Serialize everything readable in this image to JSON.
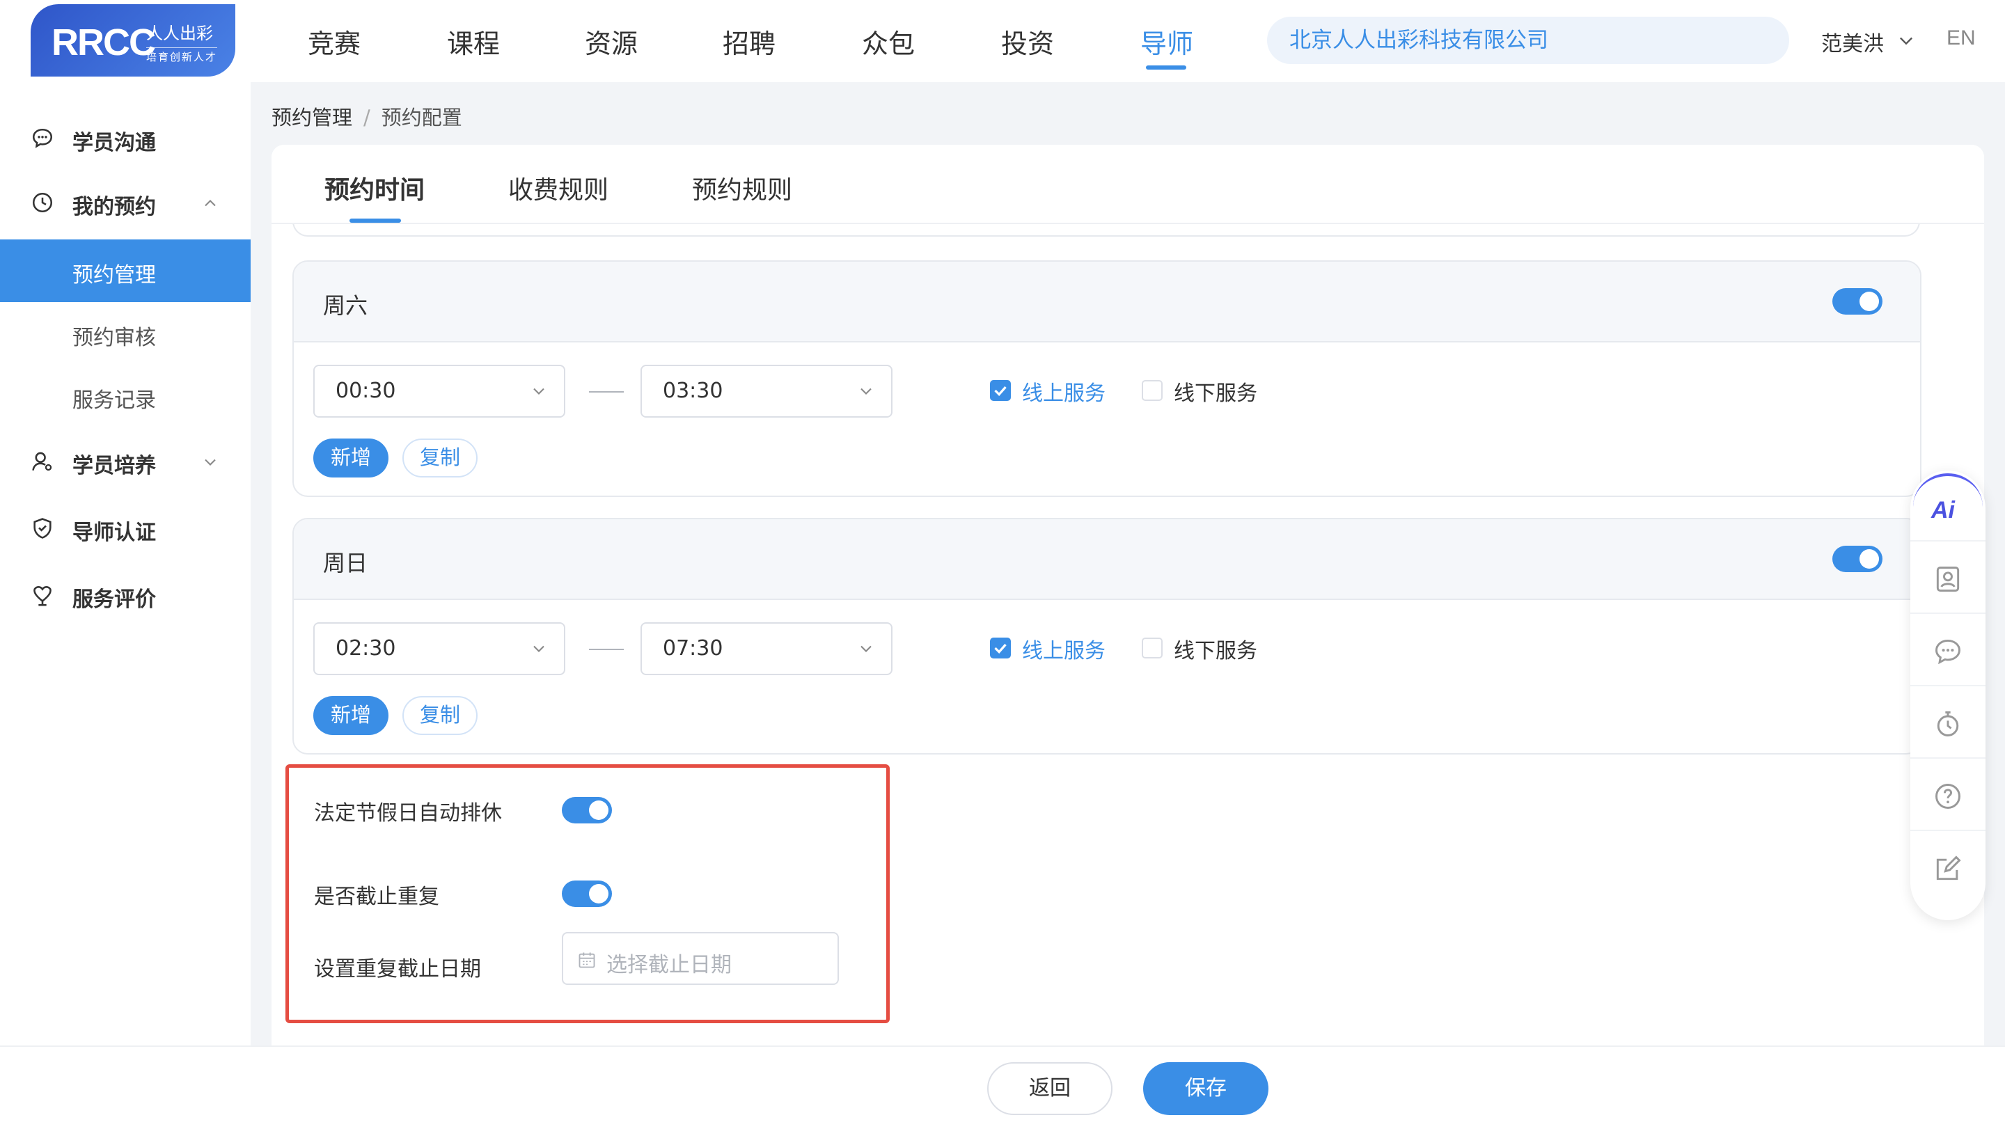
{
  "header": {
    "logo_text": "RRCC",
    "logo_sub1": "人人出彩",
    "logo_sub2": "培育创新人才",
    "nav": [
      "竞赛",
      "课程",
      "资源",
      "招聘",
      "众包",
      "投资",
      "导师"
    ],
    "active_nav": "导师",
    "company": "北京人人出彩科技有限公司",
    "user": "范美洪",
    "lang": "EN"
  },
  "sidebar": {
    "items": [
      {
        "label": "学员沟通",
        "icon": "chat-icon"
      },
      {
        "label": "我的预约",
        "icon": "clock-icon",
        "expanded": true
      },
      {
        "label": "学员培养",
        "icon": "user-icon",
        "expanded": false
      },
      {
        "label": "导师认证",
        "icon": "shield-icon"
      },
      {
        "label": "服务评价",
        "icon": "rating-icon"
      }
    ],
    "sub_items": [
      "预约管理",
      "预约审核",
      "服务记录"
    ],
    "active_sub": "预约管理"
  },
  "breadcrumb": [
    "预约管理",
    "预约配置"
  ],
  "tabs": [
    "预约时间",
    "收费规则",
    "预约规则"
  ],
  "active_tab": "预约时间",
  "days": [
    {
      "title": "周六",
      "enabled": true,
      "start": "00:30",
      "end": "03:30",
      "online_label": "线上服务",
      "online": true,
      "offline_label": "线下服务",
      "offline": false,
      "add_label": "新增",
      "copy_label": "复制"
    },
    {
      "title": "周日",
      "enabled": true,
      "start": "02:30",
      "end": "07:30",
      "online_label": "线上服务",
      "online": true,
      "offline_label": "线下服务",
      "offline": false,
      "add_label": "新增",
      "copy_label": "复制"
    }
  ],
  "holiday": {
    "auto_rest_label": "法定节假日自动排休",
    "auto_rest": true,
    "stop_repeat_label": "是否截止重复",
    "stop_repeat": true,
    "end_date_label": "设置重复截止日期",
    "end_date_placeholder": "选择截止日期"
  },
  "footer": {
    "back_label": "返回",
    "save_label": "保存"
  },
  "float_toolbar": {
    "ai_label": "Ai",
    "icons": [
      "contact-card-icon",
      "message-icon",
      "timer-icon",
      "help-icon",
      "edit-icon"
    ]
  },
  "colors": {
    "accent": "#3a8ee6",
    "highlight_border": "#e54d42",
    "page_bg": "#f2f4f7"
  }
}
